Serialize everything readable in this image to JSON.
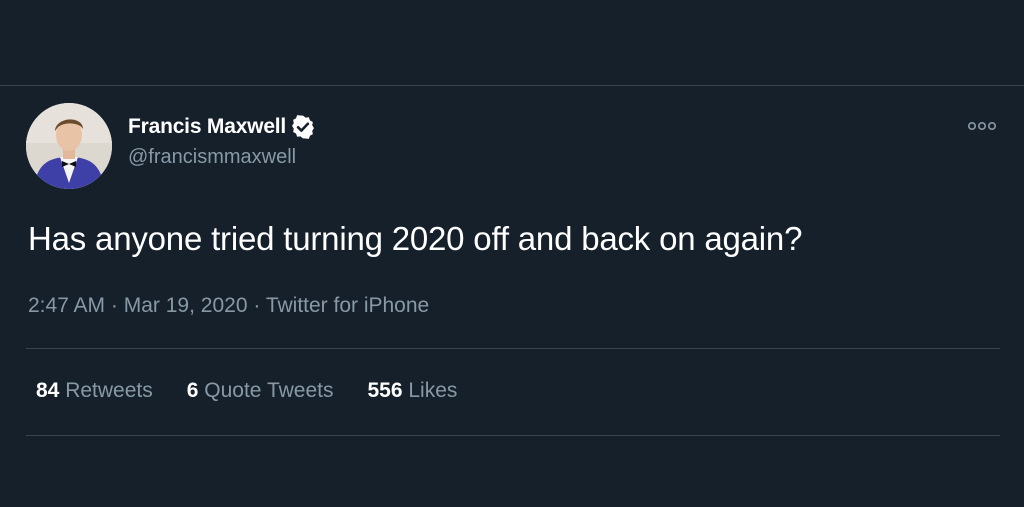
{
  "tweet": {
    "author": {
      "name": "Francis Maxwell",
      "handle": "@francismmaxwell",
      "verified": true
    },
    "text": "Has anyone tried turning 2020 off and back on again?",
    "time": "2:47 AM",
    "separator": "·",
    "date": "Mar 19, 2020",
    "source": "Twitter for iPhone",
    "stats": {
      "retweets_count": "84",
      "retweets_label": "Retweets",
      "quotes_count": "6",
      "quotes_label": "Quote Tweets",
      "likes_count": "556",
      "likes_label": "Likes"
    }
  },
  "icons": {
    "verified": "verified-badge-icon",
    "more": "more-options-icon"
  },
  "colors": {
    "background": "#15202b",
    "divider": "#38444d",
    "text_primary": "#ffffff",
    "text_secondary": "#8899a6"
  }
}
